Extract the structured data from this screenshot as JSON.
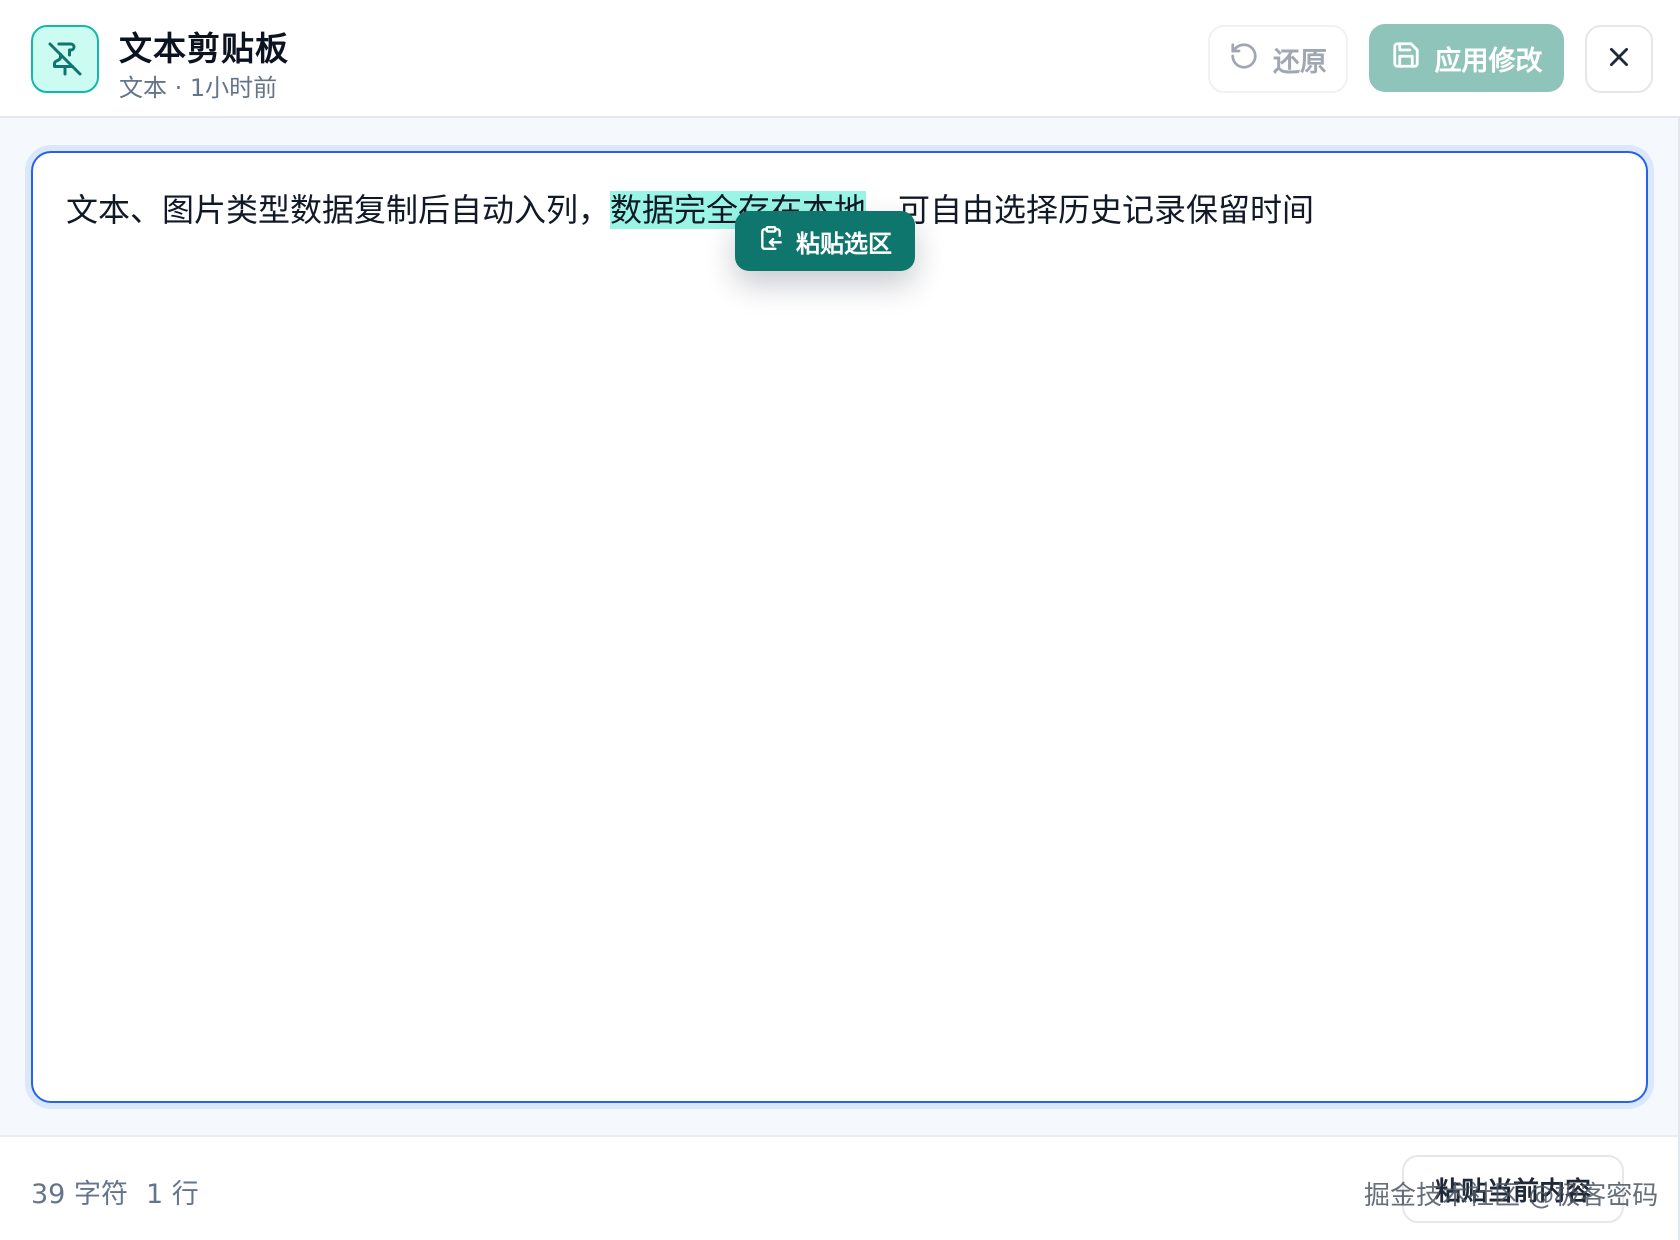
{
  "header": {
    "title": "文本剪贴板",
    "subtitle": "文本 · 1小时前",
    "restore_label": "还原",
    "apply_label": "应用修改",
    "icons": {
      "app": "pin-off-icon",
      "restore": "undo-icon",
      "apply": "save-icon",
      "close": "close-icon"
    }
  },
  "editor": {
    "text_before": "文本、图片类型数据复制后自动入列，",
    "text_selected": "数据完全存在本地",
    "text_after": "，可自由选择历史记录保留时间",
    "paste_selection_label": "粘贴选区",
    "paste_selection_icon": "clipboard-paste-icon"
  },
  "footer": {
    "char_count": "39 字符",
    "line_count": "1 行",
    "paste_current_label": "粘贴当前内容",
    "watermark": "掘金技术社区 @极客密码"
  },
  "colors": {
    "accent": "#0f766e",
    "accent_light": "#ccfbf1",
    "selection": "#99f6e4",
    "focus_border": "#2563eb",
    "apply_button": "#8fc4bb"
  }
}
